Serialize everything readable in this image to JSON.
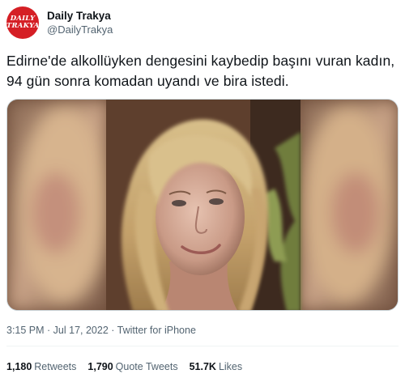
{
  "author": {
    "display_name": "Daily Trakya",
    "handle": "@DailyTrakya",
    "avatar_logo_line1": "DAILY",
    "avatar_logo_line2": "TRAKYA",
    "avatar_color": "#d51f25"
  },
  "tweet": {
    "text": "Edirne'de alkollüyken dengesini kaybedip başını vuran kadın, 94 gün sonra komadan uyandı ve bira istedi.",
    "meta": "3:15 PM · Jul 17, 2022 · Twitter for iPhone"
  },
  "stats": [
    {
      "count": "1,180",
      "label": "Retweets"
    },
    {
      "count": "1,790",
      "label": "Quote Tweets"
    },
    {
      "count": "51.7K",
      "label": "Likes"
    }
  ],
  "colors": {
    "text_primary": "#0f1419",
    "text_secondary": "#536471",
    "divider": "#eff3f4"
  }
}
